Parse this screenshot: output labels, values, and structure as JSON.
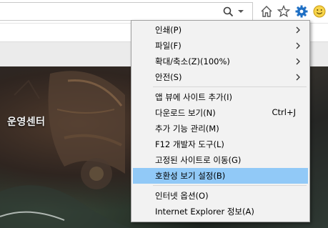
{
  "toolbar": {
    "search_icon": "search-icon",
    "dropdown_icon": "chevron-down-icon",
    "home_icon": "home-icon",
    "favorites_icon": "star-icon",
    "tools_icon": "gear-icon",
    "feedback_icon": "smiley-icon",
    "accent_color": "#1e6fc4"
  },
  "page": {
    "banner_title": "운영센터"
  },
  "menu": {
    "items": [
      {
        "label": "인쇄(P)",
        "submenu": true
      },
      {
        "label": "파일(F)",
        "submenu": true
      },
      {
        "label": "확대/축소(Z)(100%)",
        "submenu": true
      },
      {
        "label": "안전(S)",
        "submenu": true
      },
      {
        "label": "앱 뷰에 사이트 추가(I)"
      },
      {
        "label": "다운로드 보기(N)",
        "shortcut": "Ctrl+J"
      },
      {
        "label": "추가 기능 관리(M)"
      },
      {
        "label": "F12 개발자 도구(L)"
      },
      {
        "label": "고정된 사이트로 이동(G)"
      },
      {
        "label": "호환성 보기 설정(B)",
        "highlighted": true
      },
      {
        "label": "인터넷 옵션(O)"
      },
      {
        "label": "Internet Explorer 정보(A)"
      }
    ],
    "highlight_color": "#91c9f7"
  }
}
